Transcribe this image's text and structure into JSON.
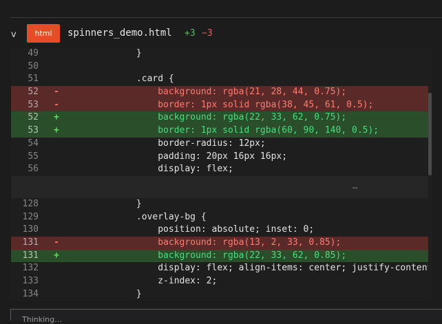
{
  "file": {
    "chevron": "v",
    "lang": "html",
    "name": "spinners_demo.html",
    "additions": "+3",
    "deletions": "−3"
  },
  "diff": {
    "gap_dots": "…",
    "block1": [
      {
        "n": "49",
        "m": "",
        "c": "            }",
        "t": "ctx"
      },
      {
        "n": "50",
        "m": "",
        "c": "",
        "t": "ctx"
      },
      {
        "n": "51",
        "m": "",
        "c": "            .card {",
        "t": "ctx"
      },
      {
        "n": "52",
        "m": "-",
        "c": "                background: rgba(21, 28, 44, 0.75);",
        "t": "del"
      },
      {
        "n": "53",
        "m": "-",
        "c": "                border: 1px solid rgba(38, 45, 61, 0.5);",
        "t": "del"
      },
      {
        "n": "52",
        "m": "+",
        "c": "                background: rgba(22, 33, 62, 0.75);",
        "t": "add"
      },
      {
        "n": "53",
        "m": "+",
        "c": "                border: 1px solid rgba(60, 90, 140, 0.5);",
        "t": "add"
      },
      {
        "n": "54",
        "m": "",
        "c": "                border-radius: 12px;",
        "t": "ctx"
      },
      {
        "n": "55",
        "m": "",
        "c": "                padding: 20px 16px 16px;",
        "t": "ctx"
      },
      {
        "n": "56",
        "m": "",
        "c": "                display: flex;",
        "t": "ctx"
      }
    ],
    "block2": [
      {
        "n": "128",
        "m": "",
        "c": "            }",
        "t": "ctx"
      },
      {
        "n": "129",
        "m": "",
        "c": "            .overlay-bg {",
        "t": "ctx"
      },
      {
        "n": "130",
        "m": "",
        "c": "                position: absolute; inset: 0;",
        "t": "ctx"
      },
      {
        "n": "131",
        "m": "-",
        "c": "                background: rgba(13, 2, 33, 0.85);",
        "t": "del"
      },
      {
        "n": "131",
        "m": "+",
        "c": "                background: rgba(22, 33, 62, 0.85);",
        "t": "add"
      },
      {
        "n": "132",
        "m": "",
        "c": "                display: flex; align-items: center; justify-content",
        "t": "ctx"
      },
      {
        "n": "133",
        "m": "",
        "c": "                z-index: 2;",
        "t": "ctx"
      },
      {
        "n": "134",
        "m": "",
        "c": "            }",
        "t": "ctx"
      }
    ]
  },
  "footer": {
    "text": "Thinking…"
  },
  "colors": {
    "badge": "#e44d26",
    "added_bg": "#2a4d2a",
    "deleted_bg": "#5a2a28",
    "added_text": "#4ade80",
    "deleted_text": "#ff7b72"
  }
}
